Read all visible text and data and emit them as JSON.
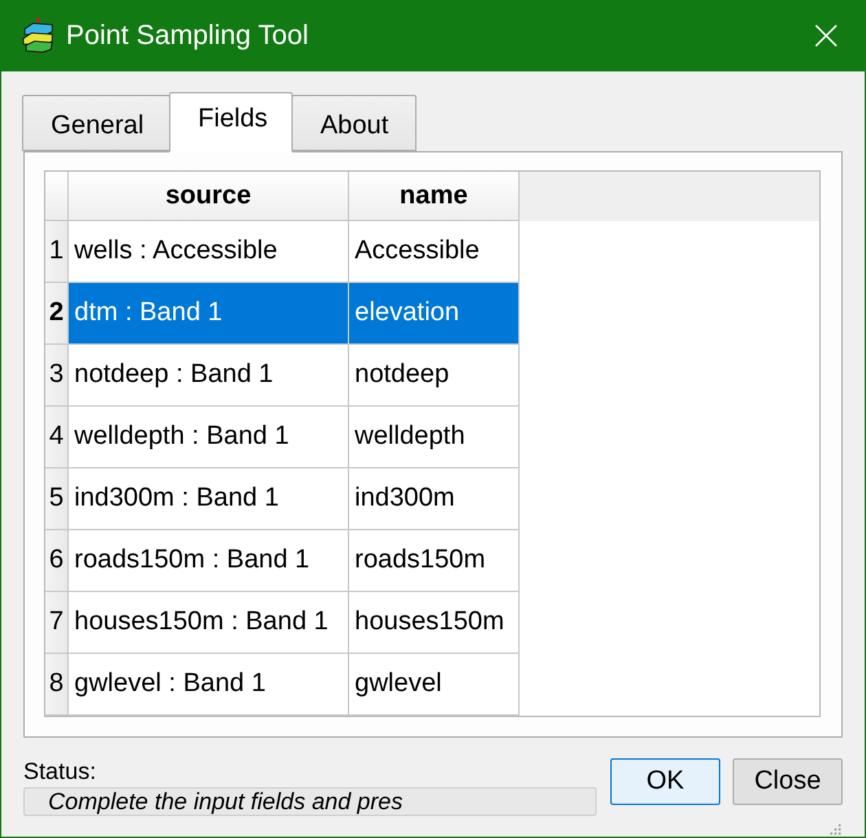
{
  "window": {
    "title": "Point Sampling Tool"
  },
  "tabs": [
    {
      "label": "General",
      "selected": false
    },
    {
      "label": "Fields",
      "selected": true
    },
    {
      "label": "About",
      "selected": false
    }
  ],
  "table": {
    "columns": [
      "source",
      "name"
    ],
    "rows": [
      {
        "number": "1",
        "source": "wells : Accessible",
        "name": "Accessible",
        "selected": false
      },
      {
        "number": "2",
        "source": "dtm : Band 1",
        "name": "elevation",
        "selected": true
      },
      {
        "number": "3",
        "source": "notdeep : Band 1",
        "name": "notdeep",
        "selected": false
      },
      {
        "number": "4",
        "source": "welldepth : Band 1",
        "name": "welldepth",
        "selected": false
      },
      {
        "number": "5",
        "source": "ind300m : Band 1",
        "name": "ind300m",
        "selected": false
      },
      {
        "number": "6",
        "source": "roads150m : Band 1",
        "name": "roads150m",
        "selected": false
      },
      {
        "number": "7",
        "source": "houses150m : Band 1",
        "name": "houses150m",
        "selected": false
      },
      {
        "number": "8",
        "source": "gwlevel : Band 1",
        "name": "gwlevel",
        "selected": false
      }
    ]
  },
  "status": {
    "label": "Status:",
    "value": "Complete the input fields and pres"
  },
  "buttons": [
    {
      "label": "OK",
      "default": true
    },
    {
      "label": "Close",
      "default": false
    }
  ]
}
